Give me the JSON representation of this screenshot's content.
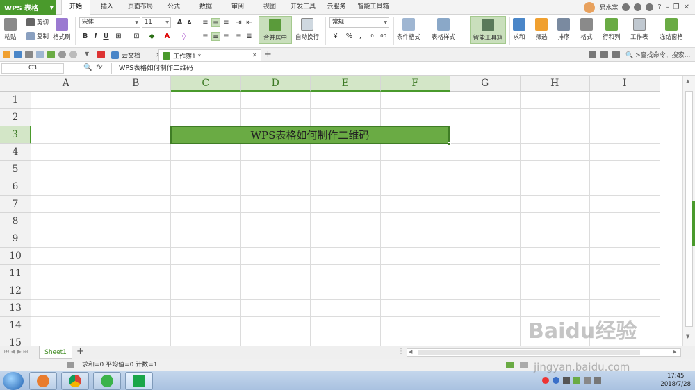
{
  "app": {
    "title": "WPS 表格"
  },
  "menu_tabs": [
    "开始",
    "插入",
    "页面布局",
    "公式",
    "数据",
    "审阅",
    "视图",
    "开发工具",
    "云服务",
    "智能工具箱"
  ],
  "user": {
    "name": "易水寒"
  },
  "ribbon": {
    "paste": "粘贴",
    "cut": "剪切",
    "copy": "复制",
    "format_painter": "格式刷",
    "font_name": "宋体",
    "font_size": "11",
    "merge_center": "合并居中",
    "wrap_text": "自动换行",
    "number_format": "常规",
    "conditional_format": "条件格式",
    "table_style": "表格样式",
    "smart_toolbox": "智能工具箱",
    "sum": "求和",
    "filter": "筛选",
    "sort": "排序",
    "format": "格式",
    "rows_cols": "行和列",
    "worksheet": "工作表",
    "freeze": "冻结窗格"
  },
  "doc_tabs": [
    {
      "label": "云文档",
      "active": false
    },
    {
      "label": "工作簿1 *",
      "active": true
    }
  ],
  "search": {
    "placeholder": ">查找命令、搜索..."
  },
  "formula_bar": {
    "cell_ref": "C3",
    "fx": "fx",
    "content": "WPS表格如何制作二维码"
  },
  "grid": {
    "columns": [
      "A",
      "B",
      "C",
      "D",
      "E",
      "F",
      "G",
      "H",
      "I"
    ],
    "rows": [
      "1",
      "2",
      "3",
      "4",
      "5",
      "6",
      "7",
      "8",
      "9",
      "10",
      "11",
      "12",
      "13",
      "14",
      "15"
    ],
    "selected_columns": [
      "C",
      "D",
      "E",
      "F"
    ],
    "selected_row": "3",
    "merged_cell_text": "WPS表格如何制作二维码",
    "merged_cell_color": "#6aab44"
  },
  "sheets": [
    "Sheet1"
  ],
  "status": {
    "text": "求和=0  平均值=0  计数=1"
  },
  "taskbar": {
    "time": "17:45",
    "date": "2018/7/28"
  },
  "watermark": {
    "text": "Baidu经验",
    "sub": "jingyan.baidu.com"
  }
}
